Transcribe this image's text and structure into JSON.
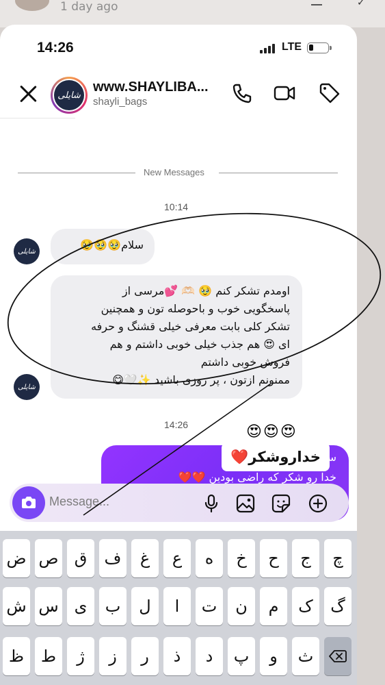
{
  "backdrop": {
    "time_ago": "1 day ago"
  },
  "status_bar": {
    "time": "14:26",
    "network": "LTE"
  },
  "header": {
    "name": "www.SHAYLIBA...",
    "username": "shayli_bags",
    "avatar_text": "شایلی"
  },
  "divider": {
    "new_messages": "New Messages"
  },
  "timestamps": {
    "first": "10:14",
    "second": "14:26"
  },
  "messages": {
    "m1": "سلام🥹🥹🥹",
    "m2_lines": [
      "اومدم تشکر کنم 🥹 🫶🏻 💕مرسی از",
      "پاسخگویی خوب و باحوصله تون و همچنین",
      "تشکر کلی بابت معرفی خیلی قشنگ و حرفه",
      "ای 😍 هم جذب خیلی خوبی داشتم و هم",
      "فروش خوبی داشتم",
      "ممنونم ازتون ، پر روزی باشید ✨🤍😋"
    ],
    "emoji_row": "😍😍😍",
    "outgoing_line1": "سلام عزیزم",
    "outgoing_line2": "خدا رو شکر که راضی بودین ❤️❤️",
    "sticker": "خداروشکر❤️"
  },
  "composer": {
    "placeholder": "Message..."
  },
  "keyboard": {
    "row1": [
      "ض",
      "ص",
      "ق",
      "ف",
      "غ",
      "ع",
      "ه",
      "خ",
      "ح",
      "ج",
      "چ"
    ],
    "row2": [
      "ش",
      "س",
      "ی",
      "ب",
      "ل",
      "ا",
      "ت",
      "ن",
      "م",
      "ک",
      "گ"
    ],
    "row3": [
      "ظ",
      "ط",
      "ژ",
      "ز",
      "ر",
      "ذ",
      "د",
      "پ",
      "و",
      "ث"
    ]
  },
  "colors": {
    "accent": "#7a47f5",
    "outgoing_bubble": "#8a38f5",
    "incoming_bubble": "#eeeef1"
  }
}
